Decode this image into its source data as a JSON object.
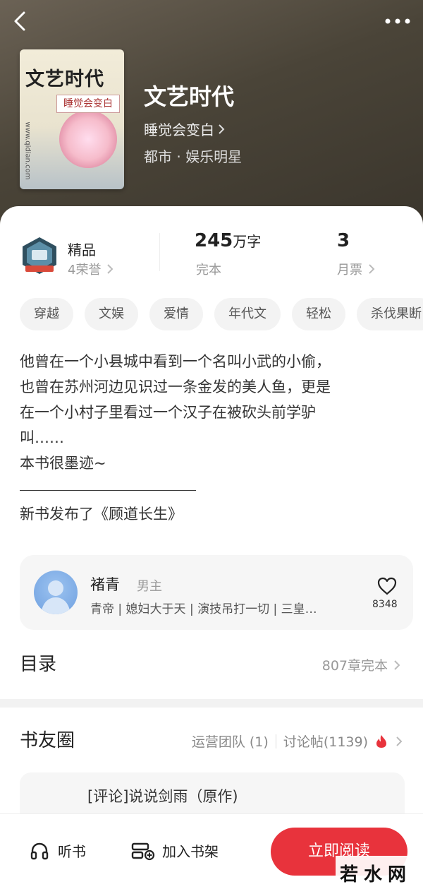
{
  "book": {
    "title": "文艺时代",
    "author": "睡觉会变白",
    "genre": "都市 · 娱乐明星",
    "cover": {
      "title": "文艺时代",
      "author": "睡觉会变白",
      "url": "www.qidian.com"
    }
  },
  "stats": {
    "quality": "精品",
    "honors": "4荣誉",
    "word_count": "245",
    "word_unit": "万字",
    "status": "完本",
    "tickets_count": "3",
    "tickets_label": "月票"
  },
  "tags": [
    "穿越",
    "文娱",
    "爱情",
    "年代文",
    "轻松",
    "杀伐果断"
  ],
  "intro": {
    "lines": [
      "他曾在一个小县城中看到一个名叫小武的小偷，",
      "也曾在苏州河边见识过一条金发的美人鱼，更是",
      "在一个小村子里看过一个汉子在被砍头前学驴",
      "叫……",
      "本书很墨迹~"
    ],
    "new_book": "新书发布了《顾道长生》"
  },
  "role": {
    "name": "褚青",
    "gender": "男主",
    "desc": "青帝 | 媳妇大于天 | 演技吊打一切 | 三皇…",
    "likes": "8348"
  },
  "toc": {
    "title": "目录",
    "summary": "807章完本"
  },
  "circle": {
    "title": "书友圈",
    "team": "运营团队 (1)",
    "posts": "讨论帖(1139)",
    "post_title": "[评论]说说剑雨（原作)"
  },
  "bottom_bar": {
    "listen": "听书",
    "add_shelf": "加入书架",
    "read_now": "立即阅读"
  },
  "watermark": "若水网",
  "colors": {
    "accent": "#e8333c",
    "header_bg": "#4a4438"
  }
}
